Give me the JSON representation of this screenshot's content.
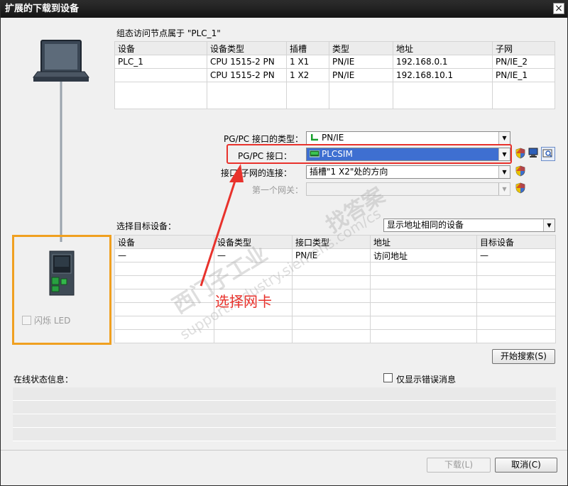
{
  "window": {
    "title": "扩展的下载到设备",
    "close_glyph": "×"
  },
  "config_section": {
    "caption": "组态访问节点属于 \"PLC_1\"",
    "columns": [
      "设备",
      "设备类型",
      "插槽",
      "类型",
      "地址",
      "子网"
    ],
    "rows": [
      [
        "PLC_1",
        "CPU 1515-2 PN",
        "1 X1",
        "PN/IE",
        "192.168.0.1",
        "PN/IE_2"
      ],
      [
        "",
        "CPU 1515-2 PN",
        "1 X2",
        "PN/IE",
        "192.168.10.1",
        "PN/IE_1"
      ],
      [
        "",
        "",
        "",
        "",
        "",
        ""
      ]
    ]
  },
  "interface": {
    "type_label": "PG/PC 接口的类型：",
    "type_value": "PN/IE",
    "pgpc_label": "PG/PC 接口：",
    "pgpc_value": "PLCSIM",
    "conn_label": "接口/子网的连接：",
    "conn_value": "插槽\"1 X2\"处的方向",
    "gateway_label": "第一个网关：",
    "gateway_value": ""
  },
  "target_section": {
    "caption": "选择目标设备：",
    "filter_value": "显示地址相同的设备",
    "columns": [
      "设备",
      "设备类型",
      "接口类型",
      "地址",
      "目标设备"
    ],
    "rows": [
      [
        "—",
        "—",
        "PN/IE",
        "访问地址",
        "—"
      ],
      [
        "",
        "",
        "",
        "",
        ""
      ],
      [
        "",
        "",
        "",
        "",
        ""
      ],
      [
        "",
        "",
        "",
        "",
        ""
      ],
      [
        "",
        "",
        "",
        "",
        ""
      ],
      [
        "",
        "",
        "",
        "",
        ""
      ],
      [
        "",
        "",
        "",
        "",
        ""
      ]
    ],
    "search_button": "开始搜索(S)"
  },
  "left_panel": {
    "flash_led_label": "闪烁 LED"
  },
  "status_section": {
    "caption": "在线状态信息：",
    "errors_only_label": "仅显示错误消息"
  },
  "annotation": {
    "text": "选择网卡",
    "color": "#e8322c"
  },
  "watermark": {
    "line1": "西门子工业",
    "line2": "找答案",
    "line3": "support.industry.siemens.com/cs"
  },
  "buttons": {
    "download": "下载(L)",
    "cancel": "取消(C)"
  },
  "colors": {
    "accent": "#3e6fd1",
    "highlight_frame": "#f0a020",
    "annotation": "#e8322c"
  }
}
